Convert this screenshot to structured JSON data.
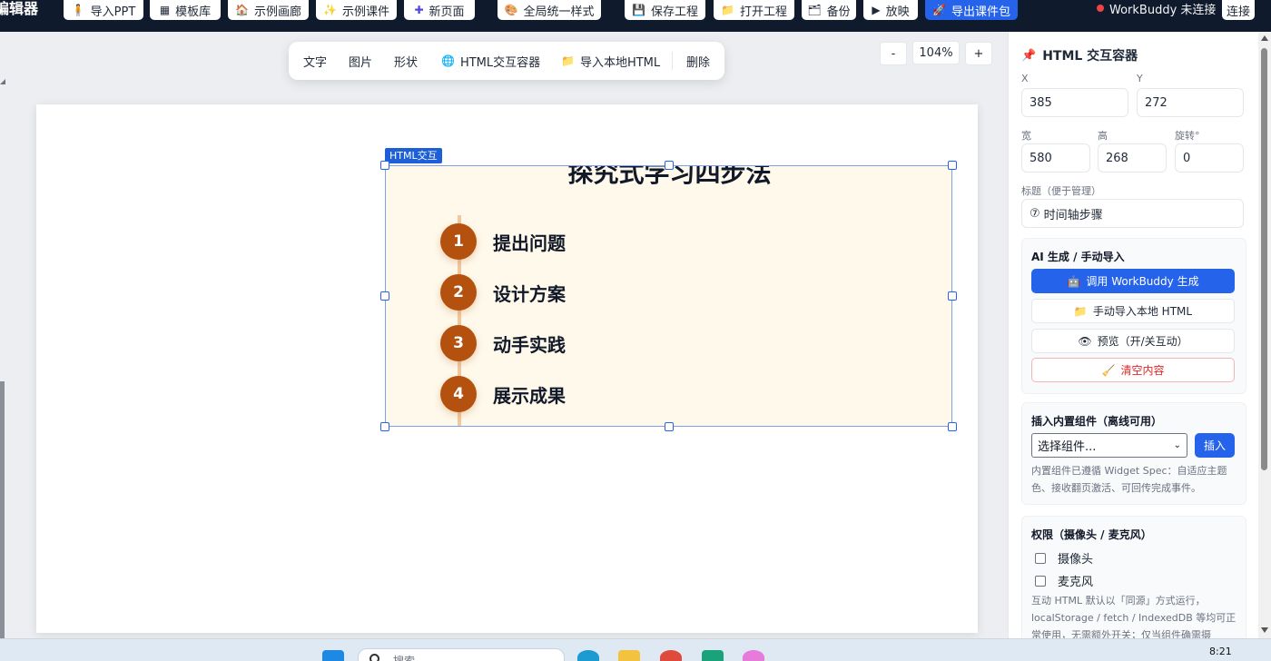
{
  "app": {
    "title": "编辑器"
  },
  "toolbar": {
    "buttons": [
      {
        "icon": "🧍",
        "label": "导入PPT"
      },
      {
        "icon": "▦",
        "label": "模板库"
      },
      {
        "icon": "🏠",
        "label": "示例画廊"
      },
      {
        "icon": "✨",
        "label": "示例课件"
      },
      {
        "icon": "✚",
        "label": "新页面"
      },
      {
        "icon": "🎨",
        "label": "全局统一样式"
      },
      {
        "icon": "💾",
        "label": "保存工程"
      },
      {
        "icon": "📁",
        "label": "打开工程"
      },
      {
        "icon": "🗂",
        "label": "备份"
      },
      {
        "icon": "▶",
        "label": "放映"
      },
      {
        "icon": "🚀",
        "label": "导出课件包"
      }
    ],
    "status_text": "WorkBuddy 未连接",
    "status_color": "#ef4444",
    "connect_label": "连接"
  },
  "float_toolbar": {
    "text": "文字",
    "image": "图片",
    "shape": "形状",
    "html_icon": "🌐",
    "html_container": "HTML交互容器",
    "import_icon": "📁",
    "import_html": "导入本地HTML",
    "delete": "删除"
  },
  "zoom": {
    "minus": "-",
    "value": "104%",
    "plus": "+"
  },
  "widget": {
    "tag": "HTML交互",
    "title": "探究式学习四步法",
    "steps": [
      {
        "num": "1",
        "label": "提出问题"
      },
      {
        "num": "2",
        "label": "设计方案"
      },
      {
        "num": "3",
        "label": "动手实践"
      },
      {
        "num": "4",
        "label": "展示成果"
      }
    ],
    "step_color": "#b4510f",
    "background": "#fff9eb"
  },
  "panel": {
    "title_icon": "📌",
    "title": "HTML 交互容器",
    "x_label": "X",
    "x_value": "385",
    "y_label": "Y",
    "y_value": "272",
    "w_label": "宽",
    "w_value": "580",
    "h_label": "高",
    "h_value": "268",
    "rot_label": "旋转°",
    "rot_value": "0",
    "name_label": "标题（便于管理）",
    "name_icon": "⑦",
    "name_value": "时间轴步骤",
    "ai": {
      "heading": "AI 生成 / 手动导入",
      "gen_icon": "🤖",
      "gen_label": "调用 WorkBuddy 生成",
      "import_icon": "📁",
      "import_label": "手动导入本地 HTML",
      "preview_icon": "👁",
      "preview_label": "预览（开/关互动）",
      "clear_icon": "🧹",
      "clear_label": "清空内容"
    },
    "builtin": {
      "heading": "插入内置组件（离线可用）",
      "select_value": "选择组件...",
      "insert_label": "插入",
      "note": "内置组件已遵循 Widget Spec：自适应主题色、接收翻页激活、可回传完成事件。"
    },
    "perm": {
      "heading": "权限（摄像头 / 麦克风）",
      "camera": "摄像头",
      "mic": "麦克风",
      "note": "互动 HTML 默认以「同源」方式运行，localStorage / fetch / IndexedDB 等均可正常使用，无需额外开关；仅当组件确需摄"
    }
  },
  "taskbar": {
    "search_placeholder": "搜索",
    "time": "8:21"
  },
  "colors": {
    "accent": "#2563eb",
    "topbar": "#0f1a2c"
  }
}
